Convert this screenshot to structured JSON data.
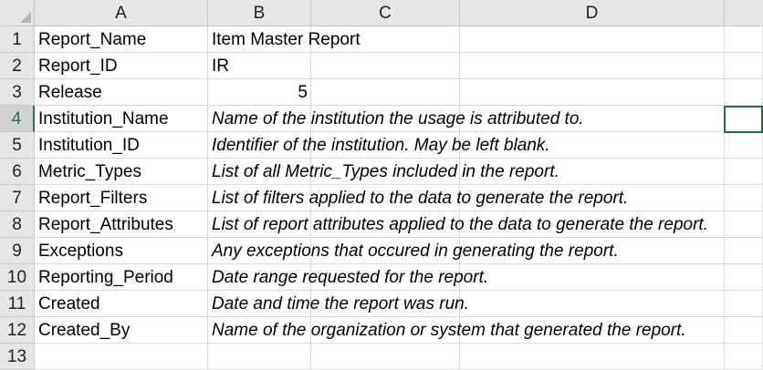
{
  "columns": [
    "A",
    "B",
    "C",
    "D"
  ],
  "rows": [
    {
      "num": "1",
      "a": "Report_Name",
      "b": "Item Master Report"
    },
    {
      "num": "2",
      "a": "Report_ID",
      "b": "IR"
    },
    {
      "num": "3",
      "a": "Release",
      "b": "5"
    },
    {
      "num": "4",
      "a": "Institution_Name",
      "b": "Name of the institution the usage is attributed to."
    },
    {
      "num": "5",
      "a": "Institution_ID",
      "b": "Identifier of the institution. May be left blank."
    },
    {
      "num": "6",
      "a": "Metric_Types",
      "b": "List of all Metric_Types included in the report."
    },
    {
      "num": "7",
      "a": "Report_Filters",
      "b": "List of filters applied to the data to generate the report."
    },
    {
      "num": "8",
      "a": "Report_Attributes",
      "b": "List of report attributes applied to the data to generate the report."
    },
    {
      "num": "9",
      "a": "Exceptions",
      "b": "Any exceptions that occured in generating the report."
    },
    {
      "num": "10",
      "a": "Reporting_Period",
      "b": "Date range requested for the report."
    },
    {
      "num": "11",
      "a": "Created",
      "b": "Date and time the report was run."
    },
    {
      "num": "12",
      "a": "Created_By",
      "b": "Name of the organization or system that generated the report."
    },
    {
      "num": "13",
      "a": "",
      "b": ""
    }
  ],
  "active_row": "4"
}
